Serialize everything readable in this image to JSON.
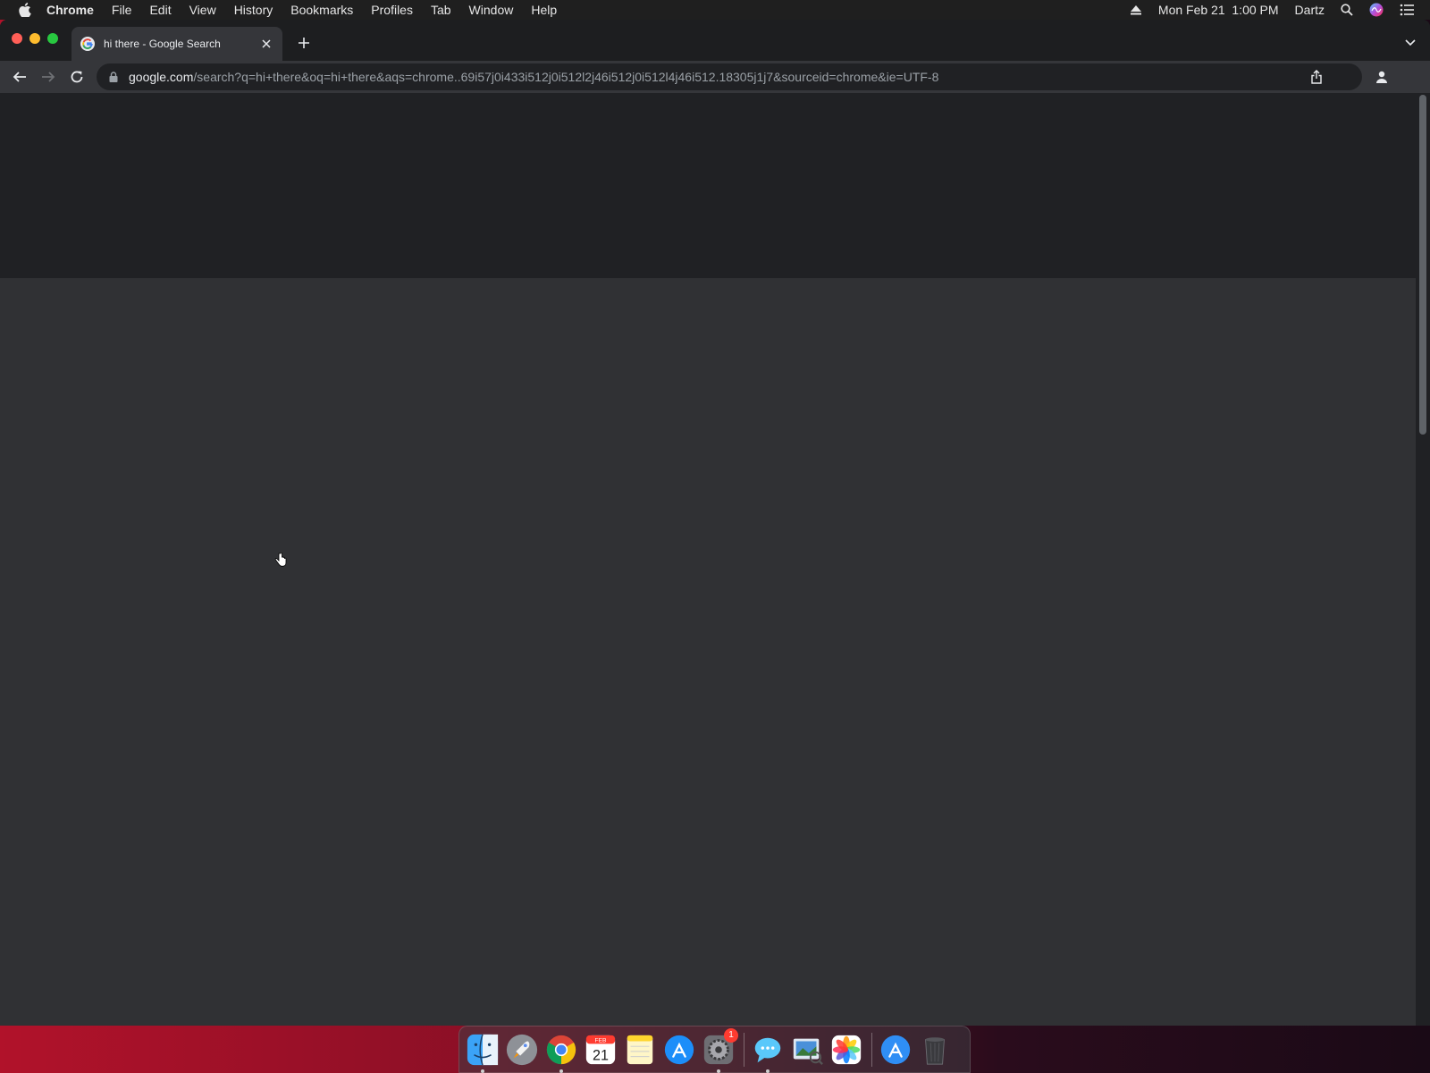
{
  "menubar": {
    "app_name": "Chrome",
    "items": [
      "File",
      "Edit",
      "View",
      "History",
      "Bookmarks",
      "Profiles",
      "Tab",
      "Window",
      "Help"
    ],
    "datetime": "Mon Feb 21  1:00 PM",
    "user": "Dartz"
  },
  "browser": {
    "tab_title": "hi there - Google Search",
    "url_host": "google.com",
    "url_path": "/search?q=hi+there&oq=hi+there&aqs=chrome..69i57j0i433i512j0i512l2j46i512j0i512l4j46i512.18305j1j7&sourceid=chrome&ie=UTF-8"
  },
  "dock": {
    "calendar_month": "FEB",
    "calendar_day": "21",
    "settings_badge": "1"
  },
  "colors": {
    "window_bg": "#202124",
    "content_bg": "#303134",
    "toolbar_bg": "#35363a"
  }
}
